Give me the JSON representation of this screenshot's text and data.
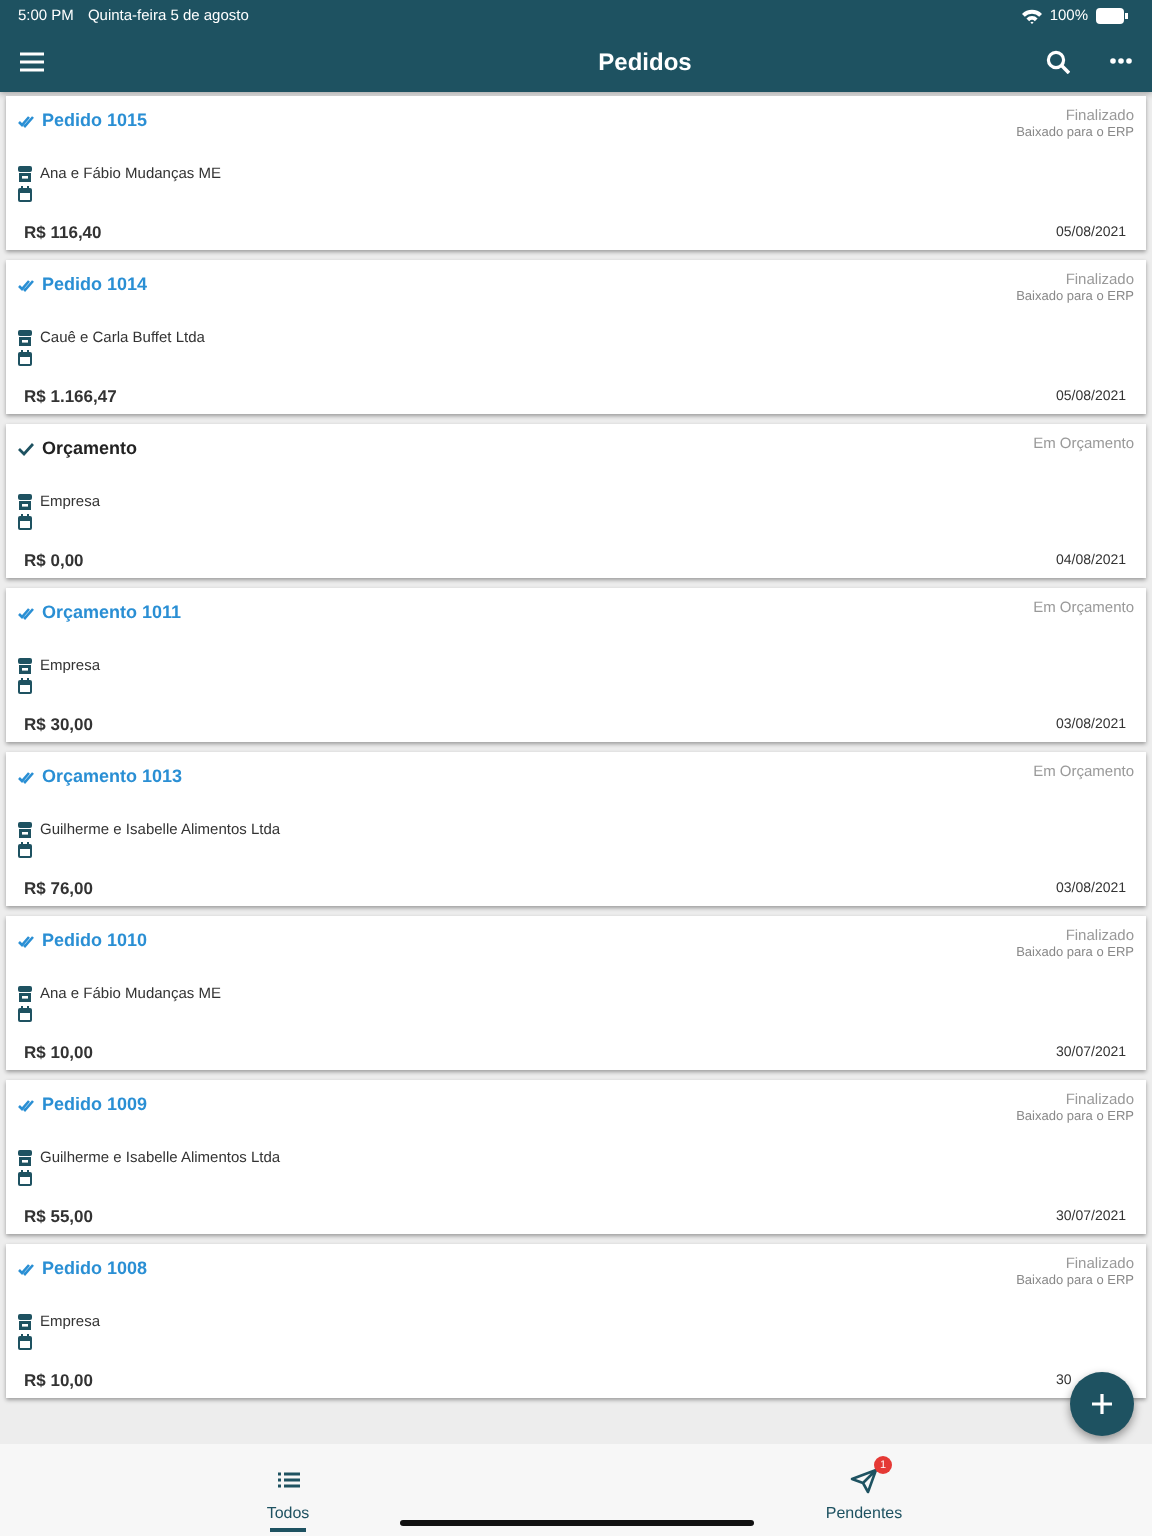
{
  "status_bar": {
    "time": "5:00 PM",
    "date": "Quinta-feira 5 de agosto",
    "battery": "100%"
  },
  "header": {
    "title": "Pedidos"
  },
  "orders": [
    {
      "title": "Pedido 1015",
      "synced": true,
      "status": "Finalizado",
      "substatus": "Baixado para o ERP",
      "customer": "Ana e Fábio Mudanças ME",
      "total": "R$ 116,40",
      "date": "05/08/2021"
    },
    {
      "title": "Pedido 1014",
      "synced": true,
      "status": "Finalizado",
      "substatus": "Baixado para o ERP",
      "customer": "Cauê e Carla Buffet Ltda",
      "total": "R$ 1.166,47",
      "date": "05/08/2021"
    },
    {
      "title": "Orçamento",
      "synced": false,
      "status": "Em Orçamento",
      "customer": "Empresa",
      "total": "R$ 0,00",
      "date": "04/08/2021"
    },
    {
      "title": "Orçamento 1011",
      "synced": true,
      "status": "Em Orçamento",
      "customer": "Empresa",
      "total": "R$ 30,00",
      "date": "03/08/2021"
    },
    {
      "title": "Orçamento 1013",
      "synced": true,
      "status": "Em Orçamento",
      "customer": "Guilherme e Isabelle Alimentos Ltda",
      "total": "R$ 76,00",
      "date": "03/08/2021"
    },
    {
      "title": "Pedido 1010",
      "synced": true,
      "status": "Finalizado",
      "substatus": "Baixado para o ERP",
      "customer": "Ana e Fábio Mudanças ME",
      "total": "R$ 10,00",
      "date": "30/07/2021"
    },
    {
      "title": "Pedido 1009",
      "synced": true,
      "status": "Finalizado",
      "substatus": "Baixado para o ERP",
      "customer": "Guilherme e Isabelle Alimentos Ltda",
      "total": "R$ 55,00",
      "date": "30/07/2021"
    },
    {
      "title": "Pedido 1008",
      "synced": true,
      "status": "Finalizado",
      "substatus": "Baixado para o ERP",
      "customer": "Empresa",
      "total": "R$ 10,00",
      "date": "30"
    }
  ],
  "tabs": [
    {
      "label": "Todos",
      "selected": true,
      "kind": "list"
    },
    {
      "label": "Pendentes",
      "selected": false,
      "kind": "send",
      "badge": "1"
    }
  ]
}
